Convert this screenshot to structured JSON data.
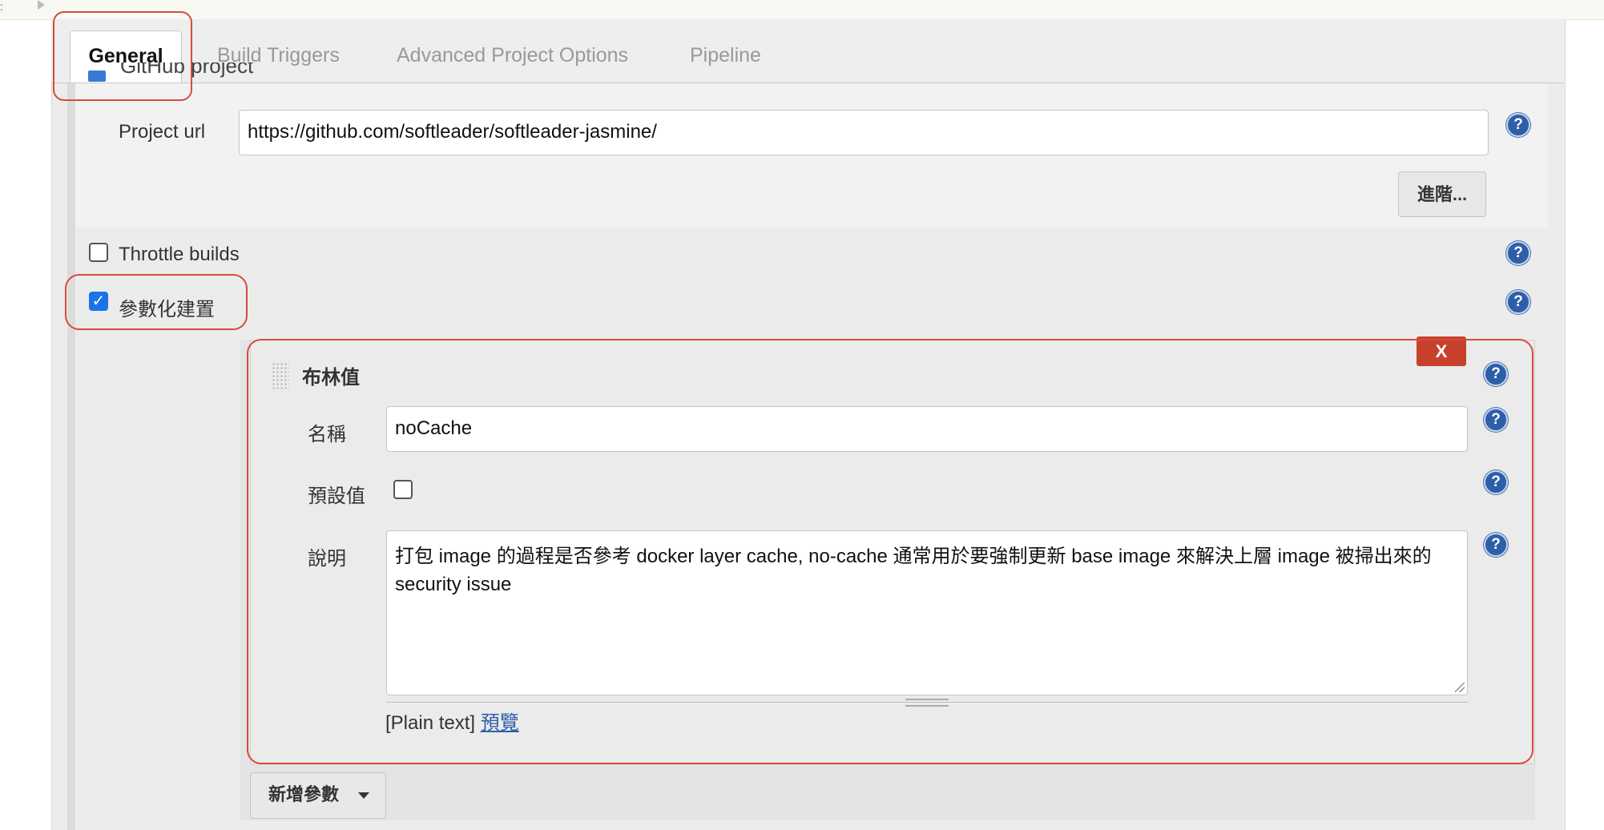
{
  "tabs": [
    {
      "label": "General"
    },
    {
      "label": "Build Triggers"
    },
    {
      "label": "Advanced Project Options"
    },
    {
      "label": "Pipeline"
    }
  ],
  "github_project": {
    "checkbox_label": "GitHub project",
    "project_url_label": "Project url",
    "project_url_value": "https://github.com/softleader/softleader-jasmine/",
    "advanced_button": "進階..."
  },
  "throttle_builds": {
    "label": "Throttle builds",
    "checked": false
  },
  "parameterized": {
    "label": "參數化建置",
    "checked": true
  },
  "boolean_param": {
    "title": "布林值",
    "delete_button": "X",
    "name_label": "名稱",
    "name_value": "noCache",
    "default_label": "預設值",
    "default_checked": false,
    "description_label": "說明",
    "description_value": "打包 image 的過程是否參考 docker layer cache, no-cache 通常用於要強制更新 base image 來解決上層 image 被掃出來的 security issue",
    "format_text": "[Plain text]",
    "preview_link": "預覽"
  },
  "add_param_button": "新增參數",
  "help_glyph": "?",
  "colors": {
    "accent": "#1a73e8",
    "help": "#2d5fa8",
    "delete": "#c8412d",
    "highlight": "#d94a3a"
  }
}
